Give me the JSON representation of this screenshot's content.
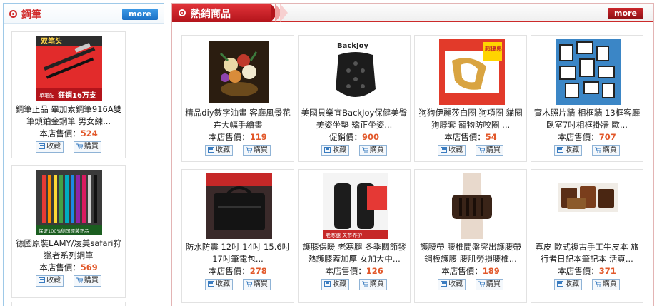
{
  "left": {
    "title": "鋼筆",
    "more": "more",
    "products": [
      {
        "name": "鋼筆正品 畢加索鋼筆916A雙筆頭鉑金鋼筆 男女練...",
        "price_label": "本店售價：",
        "price": "524",
        "thumb_text": "双笔头",
        "thumb_banner": "狂销16万支",
        "thumb_badge": "单笔配"
      },
      {
        "name": "德國原裝LAMY/凌美safari狩獵者系列鋼筆",
        "price_label": "本店售價：",
        "price": "569",
        "thumb_banner": "保证100%德国原装正品"
      }
    ]
  },
  "right": {
    "title": "熱銷商品",
    "more": "more",
    "products": [
      {
        "name": "精品diy數字油畫 客廳風景花卉大幅手繪畫",
        "price_label": "本店售價：",
        "price": "119"
      },
      {
        "name": "美國貝樂宜BackJoy保健美臀美姿坐墊 矯正坐姿...",
        "price_label": "促銷價：",
        "price": "900",
        "thumb_text": "BackJoy"
      },
      {
        "name": "狗狗伊麗莎白圈 狗項圈 貓圈 狗脖套 寵物防咬圈 ...",
        "price_label": "本店售價：",
        "price": "54",
        "thumb_badge": "超優惠"
      },
      {
        "name": "實木照片牆 相框牆 13框客廳臥室7吋相框掛牆 歐...",
        "price_label": "本店售價：",
        "price": "707"
      },
      {
        "name": "防水防震 12吋 14吋 15.6吋 17吋筆電包...",
        "price_label": "本店售價：",
        "price": "278"
      },
      {
        "name": "護膝保暖 老寒腿 冬季關節發熱護膝蓋加厚 女加大中...",
        "price_label": "本店售價：",
        "price": "126",
        "thumb_banner": "老寒腿 关节养护"
      },
      {
        "name": "護腰帶 腰椎間盤突出護腰帶 鋼板護腰 腰肌勞損腰椎...",
        "price_label": "本店售價：",
        "price": "189"
      },
      {
        "name": "真皮 歐式複古手工牛皮本 旅行者日記本筆記本 活頁...",
        "price_label": "本店售價：",
        "price": "371"
      }
    ]
  },
  "buttons": {
    "favorite": "收藏",
    "buy": "購買"
  },
  "icons": {
    "bullet": "radio-bullet-icon",
    "favorite": "favorite-icon",
    "cart": "cart-icon"
  },
  "colors": {
    "accent_red": "#d12a2a",
    "price_orange": "#e2582a",
    "more_blue": "#1b6fc4",
    "more_red": "#8f0f14"
  }
}
